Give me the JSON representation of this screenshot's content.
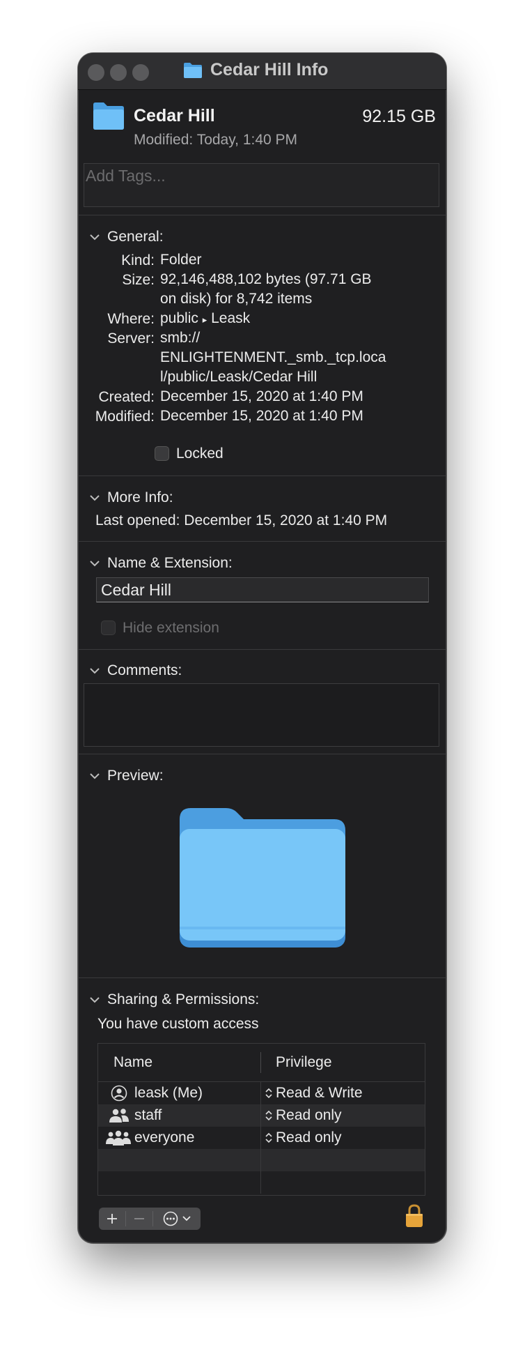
{
  "window": {
    "title": "Cedar Hill Info",
    "header": {
      "name": "Cedar Hill",
      "size": "92.15 GB",
      "modified_label": "Modified:",
      "modified_value": "Today, 1:40 PM",
      "tags_placeholder": "Add Tags..."
    }
  },
  "general": {
    "heading": "General:",
    "kind_label": "Kind:",
    "kind": "Folder",
    "size_label": "Size:",
    "size_line1": "92,146,488,102 bytes (97.71 GB",
    "size_line2": "on disk) for 8,742 items",
    "where_label": "Where:",
    "where_a": "public",
    "where_sep": "▸",
    "where_b": "Leask",
    "server_label": "Server:",
    "server_line1": "smb://",
    "server_line2": "ENLIGHTENMENT._smb._tcp.loca",
    "server_line3": "l/public/Leask/Cedar Hill",
    "created_label": "Created:",
    "created": "December 15, 2020 at 1:40 PM",
    "modified_label": "Modified:",
    "modified": "December 15, 2020 at 1:40 PM",
    "locked_label": "Locked"
  },
  "more_info": {
    "heading": "More Info:",
    "last_opened_label": "Last opened:",
    "last_opened": "December 15, 2020 at 1:40 PM"
  },
  "name_extension": {
    "heading": "Name & Extension:",
    "name_value": "Cedar Hill",
    "hide_extension_label": "Hide extension"
  },
  "comments": {
    "heading": "Comments:"
  },
  "preview": {
    "heading": "Preview:"
  },
  "sharing": {
    "heading": "Sharing & Permissions:",
    "access_text": "You have custom access",
    "col_name": "Name",
    "col_privilege": "Privilege",
    "rows": [
      {
        "name": "leask (Me)",
        "privilege": "Read & Write",
        "icon": "person-icon"
      },
      {
        "name": "staff",
        "privilege": "Read only",
        "icon": "group-icon"
      },
      {
        "name": "everyone",
        "privilege": "Read only",
        "icon": "everyone-icon"
      }
    ]
  },
  "colors": {
    "folder_blue": "#62b6f3",
    "window_bg": "#1f1f21",
    "lock_gold": "#e6a43a"
  }
}
